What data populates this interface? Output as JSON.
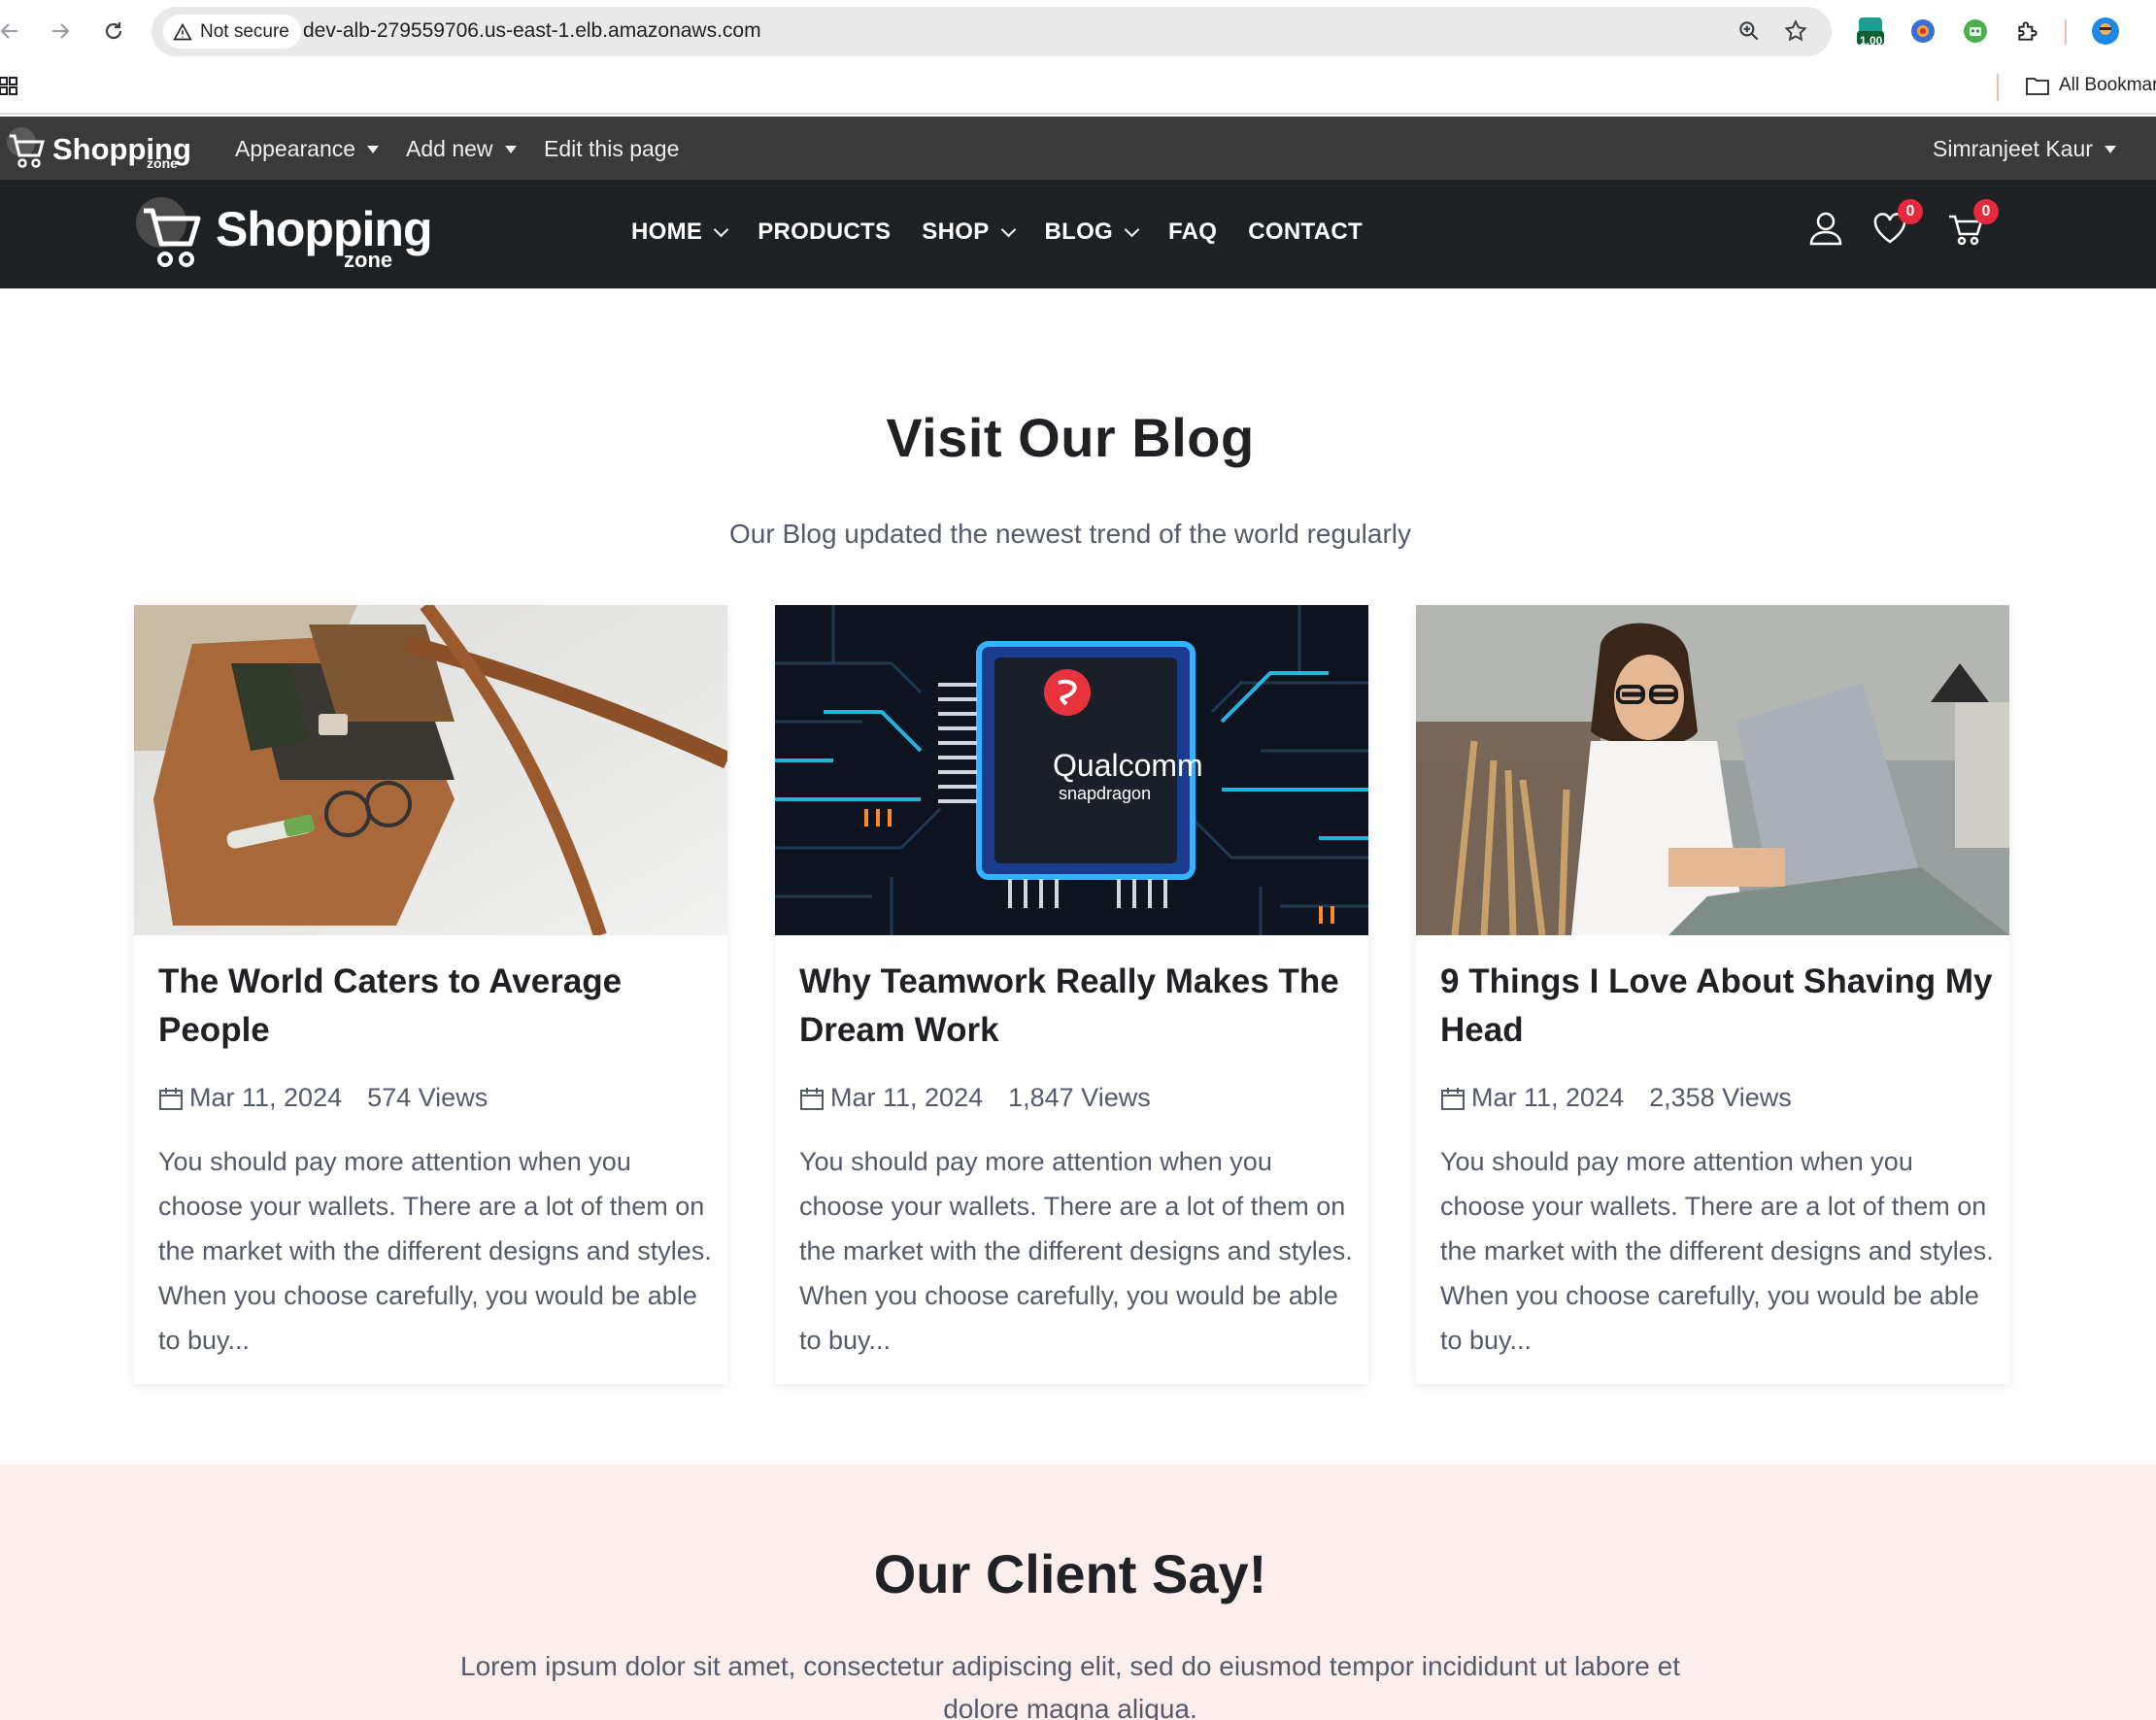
{
  "browser": {
    "not_secure_label": "Not secure",
    "url": "dev-alb-279559706.us-east-1.elb.amazonaws.com",
    "extension_badge": "1.00",
    "bookmarks_label": "All Bookmarks"
  },
  "admin_bar": {
    "logo_text": "Shopping",
    "logo_sub": "zone",
    "menu": [
      {
        "label": "Appearance",
        "has_dropdown": true
      },
      {
        "label": "Add new",
        "has_dropdown": true
      },
      {
        "label": "Edit this page",
        "has_dropdown": false
      }
    ],
    "user_name": "Simranjeet Kaur"
  },
  "header": {
    "logo_text": "Shopping",
    "logo_sub": "zone",
    "nav": [
      {
        "label": "HOME",
        "has_dropdown": true
      },
      {
        "label": "PRODUCTS",
        "has_dropdown": false
      },
      {
        "label": "SHOP",
        "has_dropdown": true
      },
      {
        "label": "BLOG",
        "has_dropdown": true
      },
      {
        "label": "FAQ",
        "has_dropdown": false
      },
      {
        "label": "CONTACT",
        "has_dropdown": false
      }
    ],
    "wishlist_count": "0",
    "cart_count": "0"
  },
  "blog": {
    "title": "Visit Our Blog",
    "subtitle": "Our Blog updated the newest trend of the world regularly",
    "posts": [
      {
        "title": "The World Caters to Average People",
        "date": "Mar 11, 2024",
        "views": "574 Views",
        "excerpt": "You should pay more attention when you choose your wallets. There are a lot of them on the market with the different designs and styles. When you choose carefully, you would be able to buy..."
      },
      {
        "title": "Why Teamwork Really Makes The Dream Work",
        "date": "Mar 11, 2024",
        "views": "1,847 Views",
        "excerpt": "You should pay more attention when you choose your wallets. There are a lot of them on the market with the different designs and styles. When you choose carefully, you would be able to buy...",
        "image_text_1": "Qualcomm",
        "image_text_2": "snapdragon"
      },
      {
        "title": "9 Things I Love About Shaving My Head",
        "date": "Mar 11, 2024",
        "views": "2,358 Views",
        "excerpt": "You should pay more attention when you choose your wallets. There are a lot of them on the market with the different designs and styles. When you choose carefully, you would be able to buy..."
      }
    ]
  },
  "clients": {
    "title": "Our Client Say!",
    "text": "Lorem ipsum dolor sit amet, consectetur adipiscing elit, sed do eiusmod tempor incididunt ut labore et dolore magna aliqua."
  },
  "colors": {
    "admin_bar": "#3a3a3a",
    "header": "#1e2124",
    "badge": "#e8283b",
    "client_bg": "#fdeeee"
  }
}
